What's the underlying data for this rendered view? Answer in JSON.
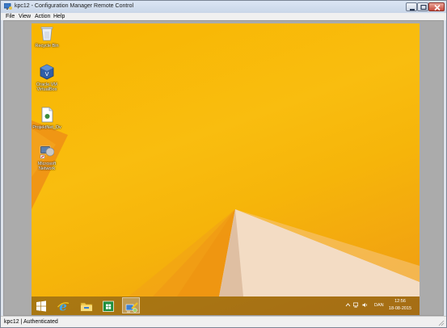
{
  "window": {
    "title": "kpc12 - Configuration Manager Remote Control"
  },
  "menubar": {
    "items": [
      {
        "label": "File"
      },
      {
        "label": "View"
      },
      {
        "label": "Action"
      },
      {
        "label": "Help"
      }
    ]
  },
  "desktop": {
    "icons": [
      {
        "label": "Recycle Bin",
        "icon": "recycle-bin-icon"
      },
      {
        "label": "Oracle VM VirtualBox",
        "icon": "virtualbox-icon"
      },
      {
        "label": "ProjektNet_Dv",
        "icon": "document-icon"
      },
      {
        "label": "Microsoft Network",
        "icon": "network-icon"
      }
    ]
  },
  "taskbar": {
    "pinned": [
      {
        "name": "start",
        "icon": "windows-logo-icon"
      },
      {
        "name": "internet-explorer",
        "icon": "ie-icon"
      },
      {
        "name": "file-explorer",
        "icon": "folder-icon"
      },
      {
        "name": "store",
        "icon": "store-icon"
      },
      {
        "name": "remote-control",
        "icon": "remote-control-icon",
        "active": true
      }
    ],
    "tray": {
      "language": "DAN",
      "time": "12:56",
      "date": "18-08-2015"
    }
  },
  "statusbar": {
    "text": "kpc12 | Authenticated"
  },
  "colors": {
    "desktop_orange": "#f8b500",
    "triangle_light": "#f3dcc4",
    "titlebar": "#c9d6e8"
  }
}
